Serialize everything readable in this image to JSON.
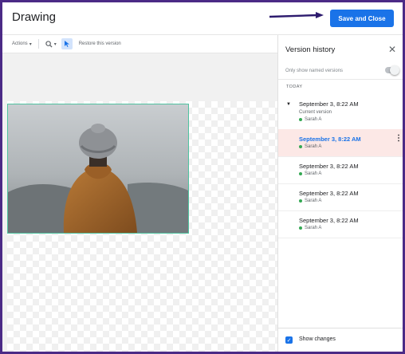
{
  "header": {
    "title": "Drawing",
    "save_label": "Save and Close"
  },
  "toolbar": {
    "actions_label": "Actions",
    "zoom_icon": "zoom-icon",
    "select_icon": "cursor-icon",
    "restore_label": "Restore this version"
  },
  "sidebar": {
    "title": "Version history",
    "toggle_label": "Only show named versions",
    "group_label": "TODAY",
    "versions": [
      {
        "date": "September 3, 8:22 AM",
        "sub": "Current version",
        "user": "Sarah A"
      },
      {
        "date": "September 3, 8:22 AM",
        "user": "Sarah A"
      },
      {
        "date": "September 3, 8:22 AM",
        "user": "Sarah A"
      },
      {
        "date": "September 3, 8:22 AM",
        "user": "Sarah A"
      },
      {
        "date": "September 3, 8:22 AM",
        "user": "Sarah A"
      }
    ],
    "show_changes_label": "Show changes"
  },
  "colors": {
    "accent": "#1a73e8",
    "selected_bg": "#fce8e6",
    "user_dot": "#34a853",
    "frame": "#4b2a86"
  }
}
